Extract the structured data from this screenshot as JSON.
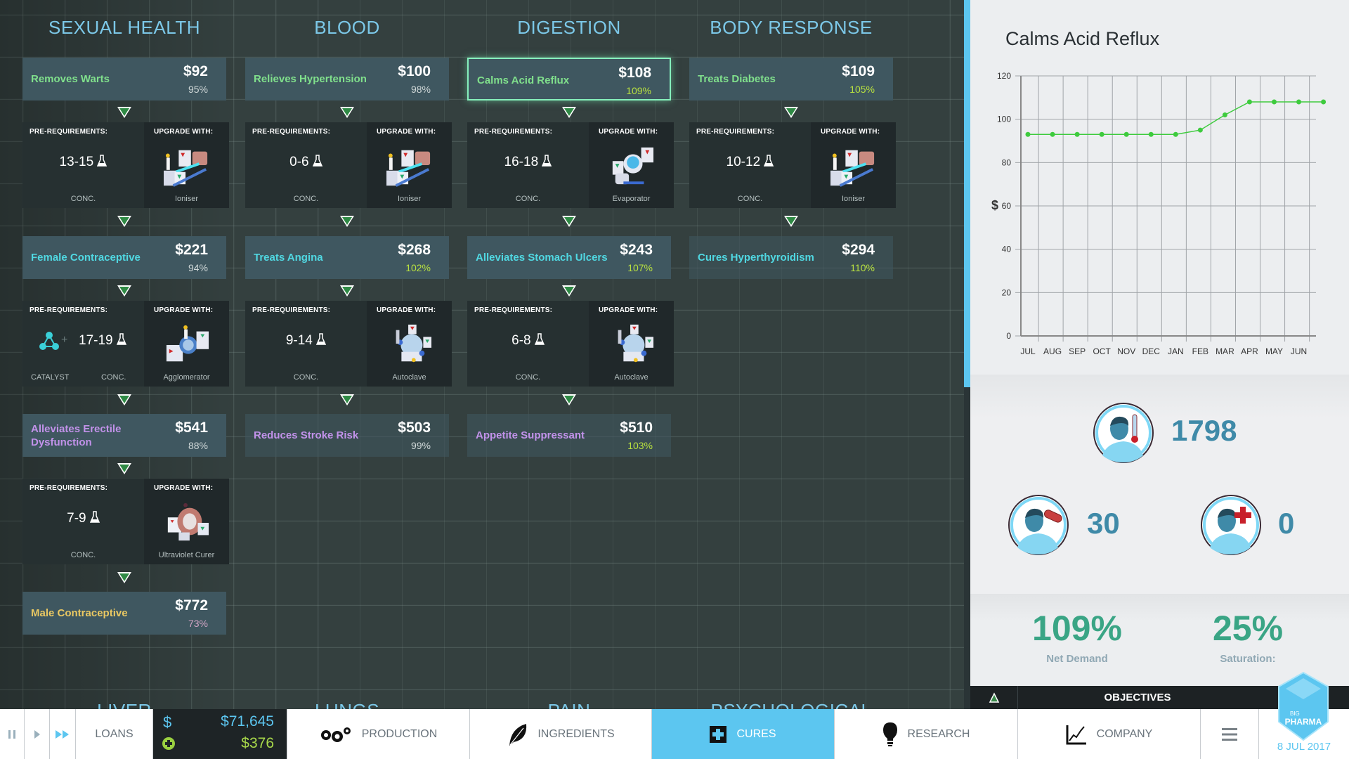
{
  "labels": {
    "prereq": "PRE-REQUIREMENTS:",
    "upgrade": "UPGRADE WITH:",
    "conc": "CONC.",
    "catalyst": "CATALYST"
  },
  "colors": {
    "tier1": "#80e08c",
    "tier2": "#50d8e2",
    "tier3": "#c292ea",
    "tier4": "#eac862",
    "demand_high": "#b8e040",
    "demand_normal": "#d0d8d8",
    "demand_low": "#d0a4c4",
    "accent": "#5cc6f0"
  },
  "columns": [
    {
      "title": "SEXUAL HEALTH",
      "cures": [
        {
          "name": "Removes Warts",
          "price": "$92",
          "demand": "95%",
          "researched": true
        },
        {
          "name": "Female Contraceptive",
          "price": "$221",
          "demand": "94%",
          "researched": true
        },
        {
          "name": "Alleviates Erectile Dysfunction",
          "price": "$541",
          "demand": "88%",
          "researched": true
        },
        {
          "name": "Male Contraceptive",
          "price": "$772",
          "demand": "73%",
          "researched": true
        }
      ],
      "upgrades": [
        {
          "conc": "13-15",
          "machine": "Ioniser"
        },
        {
          "conc": "17-19",
          "catalyst": true,
          "machine": "Agglomerator"
        },
        {
          "conc": "7-9",
          "machine": "Ultraviolet Curer"
        }
      ]
    },
    {
      "title": "BLOOD",
      "cures": [
        {
          "name": "Relieves Hypertension",
          "price": "$100",
          "demand": "98%",
          "researched": true
        },
        {
          "name": "Treats Angina",
          "price": "$268",
          "demand": "102%",
          "researched": true
        },
        {
          "name": "Reduces Stroke Risk",
          "price": "$503",
          "demand": "99%",
          "researched": false
        }
      ],
      "upgrades": [
        {
          "conc": "0-6",
          "machine": "Ioniser"
        },
        {
          "conc": "9-14",
          "machine": "Autoclave"
        }
      ]
    },
    {
      "title": "DIGESTION",
      "cures": [
        {
          "name": "Calms Acid Reflux",
          "price": "$108",
          "demand": "109%",
          "researched": true,
          "selected": true
        },
        {
          "name": "Alleviates Stomach Ulcers",
          "price": "$243",
          "demand": "107%",
          "researched": true
        },
        {
          "name": "Appetite Suppressant",
          "price": "$510",
          "demand": "103%",
          "researched": false
        }
      ],
      "upgrades": [
        {
          "conc": "16-18",
          "machine": "Evaporator"
        },
        {
          "conc": "6-8",
          "machine": "Autoclave"
        }
      ]
    },
    {
      "title": "BODY RESPONSE",
      "cures": [
        {
          "name": "Treats Diabetes",
          "price": "$109",
          "demand": "105%",
          "researched": true
        },
        {
          "name": "Cures Hyperthyroidism",
          "price": "$294",
          "demand": "110%",
          "researched": false
        }
      ],
      "upgrades": [
        {
          "conc": "10-12",
          "machine": "Ioniser"
        }
      ]
    }
  ],
  "lower_columns": [
    "LIVER",
    "LUNGS",
    "PAIN",
    "PSYCHOLOGICAL"
  ],
  "chart_data": {
    "type": "line",
    "title": "Calms Acid Reflux",
    "ylabel": "$",
    "xlabel": "",
    "categories": [
      "JUL",
      "AUG",
      "SEP",
      "OCT",
      "NOV",
      "DEC",
      "JAN",
      "FEB",
      "MAR",
      "APR",
      "MAY",
      "JUN"
    ],
    "values": [
      93,
      93,
      93,
      93,
      93,
      93,
      93,
      95,
      102,
      108,
      108,
      108,
      108
    ],
    "yticks": [
      0,
      20,
      40,
      60,
      80,
      100,
      120
    ],
    "ylim": [
      0,
      120
    ],
    "grid": true,
    "color": "#3ecb3e"
  },
  "stats": {
    "patients": "1798",
    "treated": "30",
    "cured": "0",
    "net_demand": "109%",
    "net_demand_label": "Net Demand",
    "saturation": "25%",
    "saturation_label": "Saturation:"
  },
  "objectives": "OBJECTIVES",
  "bottombar": {
    "loans": "LOANS",
    "cash_symbol": "$",
    "cash": "$71,645",
    "income": "$376",
    "production": "PRODUCTION",
    "ingredients": "INGREDIENTS",
    "cures": "CURES",
    "research": "RESEARCH",
    "company": "COMPANY",
    "date": "8 JUL 2017",
    "logo": "BIG PHARMA"
  }
}
